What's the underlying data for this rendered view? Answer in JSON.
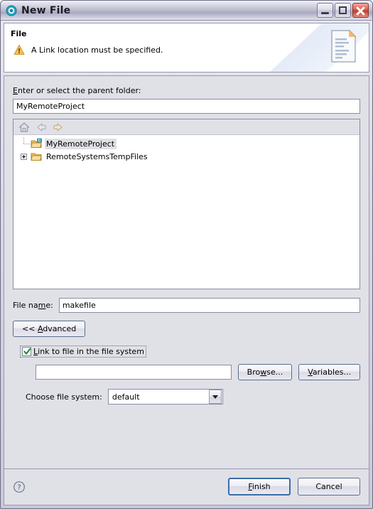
{
  "window": {
    "title": "New File",
    "title_icon": "eclipse-wizard-icon",
    "controls": {
      "minimize": "minimize-button",
      "maximize": "maximize-button",
      "close": "close-button"
    }
  },
  "header": {
    "title": "File",
    "message": "A Link location must be specified.",
    "message_icon": "warning-icon",
    "banner_icon": "new-file-document-icon"
  },
  "parent_folder": {
    "label_prefix": "E",
    "label_rest": "nter or select the parent folder:",
    "value": "MyRemoteProject",
    "placeholder": ""
  },
  "tree": {
    "toolbar": [
      {
        "name": "home-icon",
        "label": "Home"
      },
      {
        "name": "back-arrow-icon",
        "label": "Back"
      },
      {
        "name": "forward-arrow-icon",
        "label": "Forward"
      }
    ],
    "items": [
      {
        "label": "MyRemoteProject",
        "selected": true,
        "expandable": false,
        "badge": "C"
      },
      {
        "label": "RemoteSystemsTempFiles",
        "selected": false,
        "expandable": true,
        "badge": ""
      }
    ]
  },
  "file_name": {
    "label_a": "File na",
    "label_mn": "m",
    "label_b": "e:",
    "value": "makefile",
    "placeholder": ""
  },
  "advanced": {
    "button_prefix": "<< ",
    "button_mn": "A",
    "button_rest": "dvanced"
  },
  "link_option": {
    "checked": true,
    "label_mn": "L",
    "label_rest": "ink to file in the file system",
    "path_value": "",
    "path_placeholder": "",
    "browse_a": "Bro",
    "browse_mn": "w",
    "browse_b": "se...",
    "variables_mn": "V",
    "variables_rest": "ariables..."
  },
  "file_system": {
    "label": "Choose file system:",
    "selected": "default",
    "options": [
      "default"
    ]
  },
  "footer": {
    "help_icon": "help-question-icon",
    "finish_mn": "F",
    "finish_rest": "inish",
    "cancel_label": "Cancel"
  },
  "colors": {
    "dialog_bg": "#e0e0e7",
    "header_bg": "#ffffff",
    "accent_default_button": "#3a6ea5",
    "warning": "#f0a830",
    "selection": "#dfdfe4",
    "close_button": "#c63d2c"
  }
}
